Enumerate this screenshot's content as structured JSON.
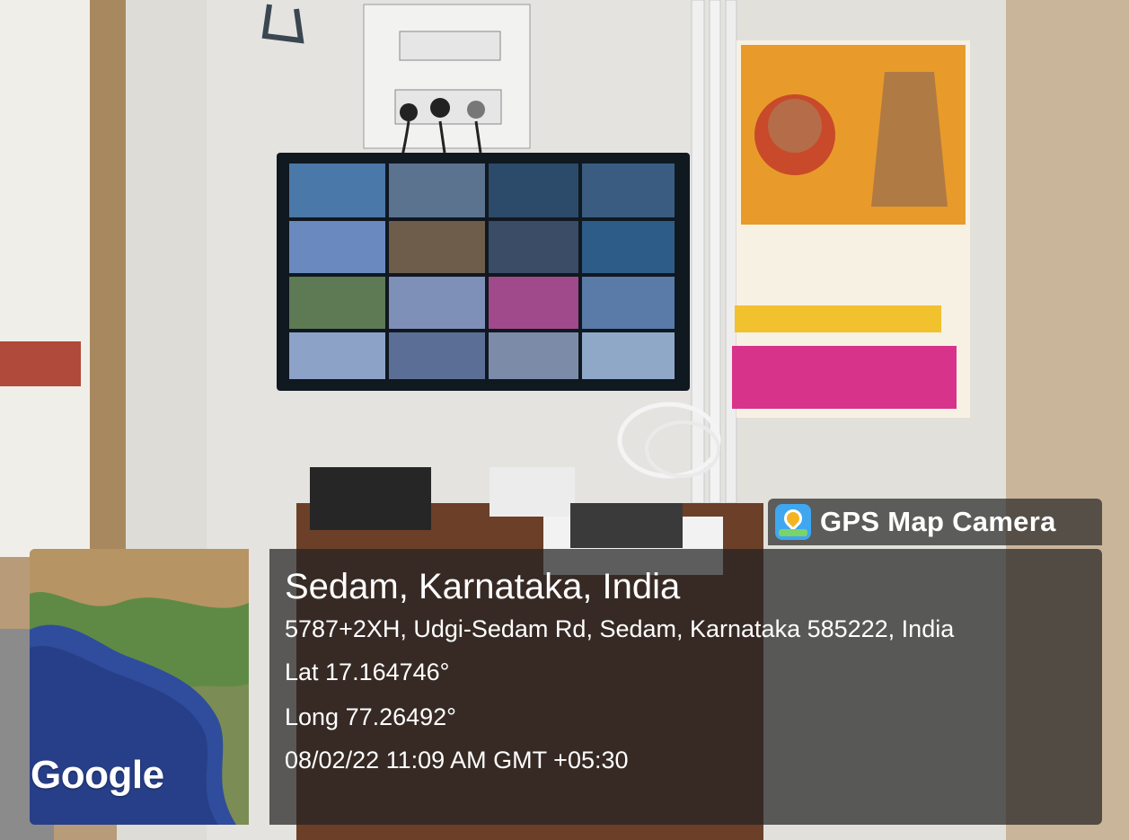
{
  "badge": {
    "label": "GPS Map Camera",
    "icon": "map-pin-icon"
  },
  "map": {
    "brand": "Google"
  },
  "location": {
    "title": "Sedam, Karnataka, India",
    "address": "5787+2XH, Udgi-Sedam Rd, Sedam, Karnataka 585222, India",
    "lat": "Lat 17.164746°",
    "long": "Long 77.26492°",
    "datetime": "08/02/22 11:09 AM GMT +05:30"
  },
  "colors": {
    "panel": "#232323",
    "badge_icon": "#3ea7f0"
  }
}
